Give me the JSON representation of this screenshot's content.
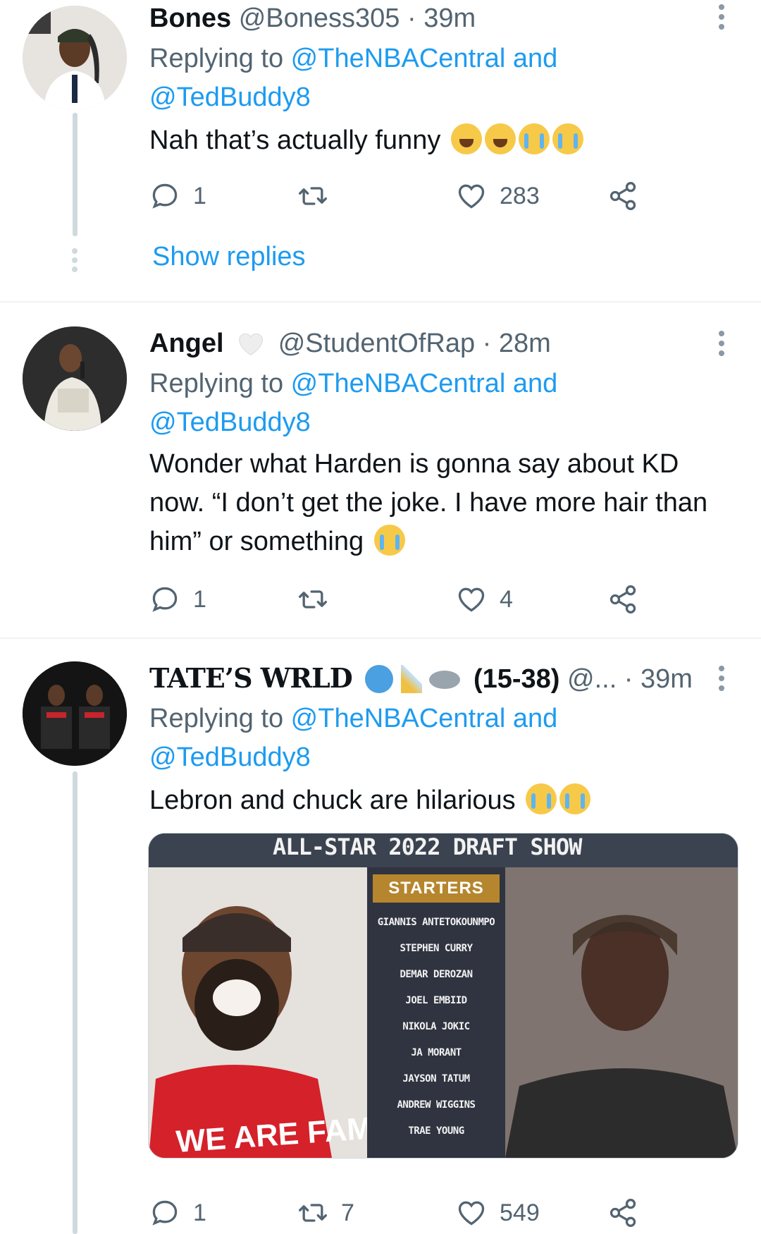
{
  "tweets": [
    {
      "name": "Bones",
      "handle": "@Boness305 · 39m",
      "replying_prefix": "Replying to ",
      "replying_to_1": "@TheNBACentral and",
      "replying_to_2": "@TedBuddy8",
      "text": "Nah that’s actually funny",
      "emojis": "😂😂😭😭",
      "reply_count": "1",
      "retweet_count": "",
      "like_count": "283",
      "show_replies": "Show replies"
    },
    {
      "name": "Angel",
      "handle": "@StudentOfRap · 28m",
      "replying_prefix": "Replying to ",
      "replying_to_1": "@TheNBACentral and",
      "replying_to_2": "@TedBuddy8",
      "text": "Wonder what Harden is gonna say about KD now. “I don’t get the joke. I have more hair than him” or something",
      "emojis": "😭",
      "reply_count": "1",
      "retweet_count": "",
      "like_count": "4"
    },
    {
      "name": "TATE’S WRLD",
      "name_suffix": "(15-38)",
      "handle": "@... · 39m",
      "replying_prefix": "Replying to ",
      "replying_to_1": "@TheNBACentral and",
      "replying_to_2": "@TedBuddy8",
      "text": "Lebron and chuck are hilarious",
      "emojis": "😭😭",
      "reply_count": "1",
      "retweet_count": "7",
      "like_count": "549",
      "media": {
        "banner": "ALL-STAR 2022 DRAFT SHOW",
        "list_title": "STARTERS",
        "players": [
          "GIANNIS ANTETOKOUNMPO",
          "STEPHEN CURRY",
          "DEMAR DEROZAN",
          "JOEL EMBIID",
          "NIKOLA JOKIC",
          "JA MORANT",
          "JAYSON TATUM",
          "ANDREW WIGGINS",
          "TRAE YOUNG"
        ],
        "shirt_text": "WE ARE FAMILY"
      }
    }
  ],
  "colors": {
    "accent": "#1d9bf0",
    "secondary_text": "#536471",
    "divider": "#eff3f4"
  },
  "icons": {
    "reply": "reply-icon",
    "retweet": "retweet-icon",
    "like": "heart-icon",
    "share": "share-icon",
    "more": "more-icon"
  }
}
